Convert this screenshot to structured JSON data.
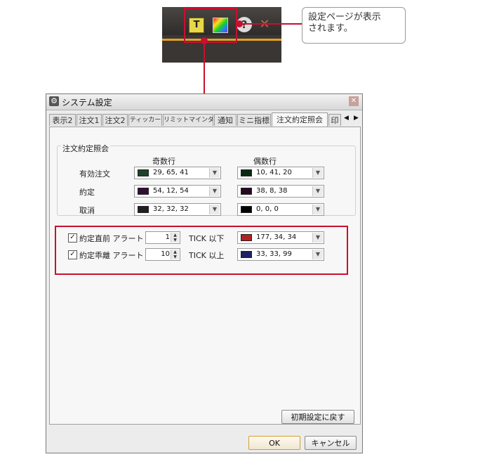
{
  "callout": {
    "line1": "設定ページが表示",
    "line2": "されます。"
  },
  "toolbar": {
    "t_icon_glyph": "T",
    "help_icon_glyph": "?",
    "close_icon_glyph": "✕"
  },
  "dialog": {
    "title": "システム設定",
    "close_glyph": "✕",
    "tabs": [
      "表示2",
      "注文1",
      "注文2",
      "ティッカー",
      "リミットマインダー",
      "通知",
      "ミニ指標",
      "注文約定照会",
      "印"
    ],
    "active_tab_index": 7,
    "tab_left_arrow": "◀",
    "tab_right_arrow": "▶",
    "group_title": "注文約定照会",
    "col_odd": "奇数行",
    "col_even": "偶数行",
    "rows": [
      {
        "label": "有効注文",
        "odd": {
          "text": "29, 65, 41",
          "color": "#1d4129"
        },
        "even": {
          "text": "10, 41, 20",
          "color": "#0a2914"
        }
      },
      {
        "label": "約定",
        "odd": {
          "text": "54, 12, 54",
          "color": "#360c36"
        },
        "even": {
          "text": "38, 8, 38",
          "color": "#260826"
        }
      },
      {
        "label": "取消",
        "odd": {
          "text": "32, 32, 32",
          "color": "#202020"
        },
        "even": {
          "text": "0, 0, 0",
          "color": "#000000"
        }
      }
    ],
    "alerts": [
      {
        "label": "約定直前 アラート",
        "checked": true,
        "spin": "1",
        "tick": "TICK 以下",
        "color_text": "177, 34, 34",
        "color": "#b12222"
      },
      {
        "label": "約定乖離 アラート",
        "checked": true,
        "spin": "10",
        "tick": "TICK 以上",
        "color_text": "33, 33, 99",
        "color": "#212163"
      }
    ],
    "check_glyph": "✓",
    "reset_button": "初期設定に戻す",
    "ok_button": "OK",
    "cancel_button": "キャンセル"
  }
}
